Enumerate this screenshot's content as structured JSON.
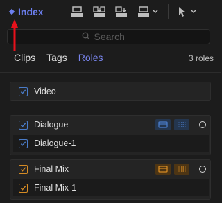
{
  "toolbar": {
    "index_label": "Index",
    "icons": [
      "clip-appearance-icon",
      "clip-append-icon",
      "clip-insert-icon",
      "clip-overwrite-icon",
      "select-tool-icon"
    ]
  },
  "search": {
    "placeholder": "Search"
  },
  "tabs": [
    {
      "label": "Clips",
      "active": false
    },
    {
      "label": "Tags",
      "active": false
    },
    {
      "label": "Roles",
      "active": true
    }
  ],
  "roles_count": "3 roles",
  "roles": {
    "video": {
      "label": "Video",
      "checked": true,
      "color": "#4a7cc9"
    },
    "dialogue": {
      "label": "Dialogue",
      "checked": true,
      "color": "#4a7cc9",
      "subroles": [
        {
          "label": "Dialogue-1",
          "checked": true
        }
      ]
    },
    "final_mix": {
      "label": "Final Mix",
      "checked": true,
      "color": "#d58b24",
      "subroles": [
        {
          "label": "Final Mix-1",
          "checked": true
        }
      ]
    }
  },
  "colors": {
    "accent": "#6c7ff0",
    "dialogue_role": "#4a7cc9",
    "effects_role": "#d58b24",
    "annotation_arrow": "#e8111b"
  }
}
